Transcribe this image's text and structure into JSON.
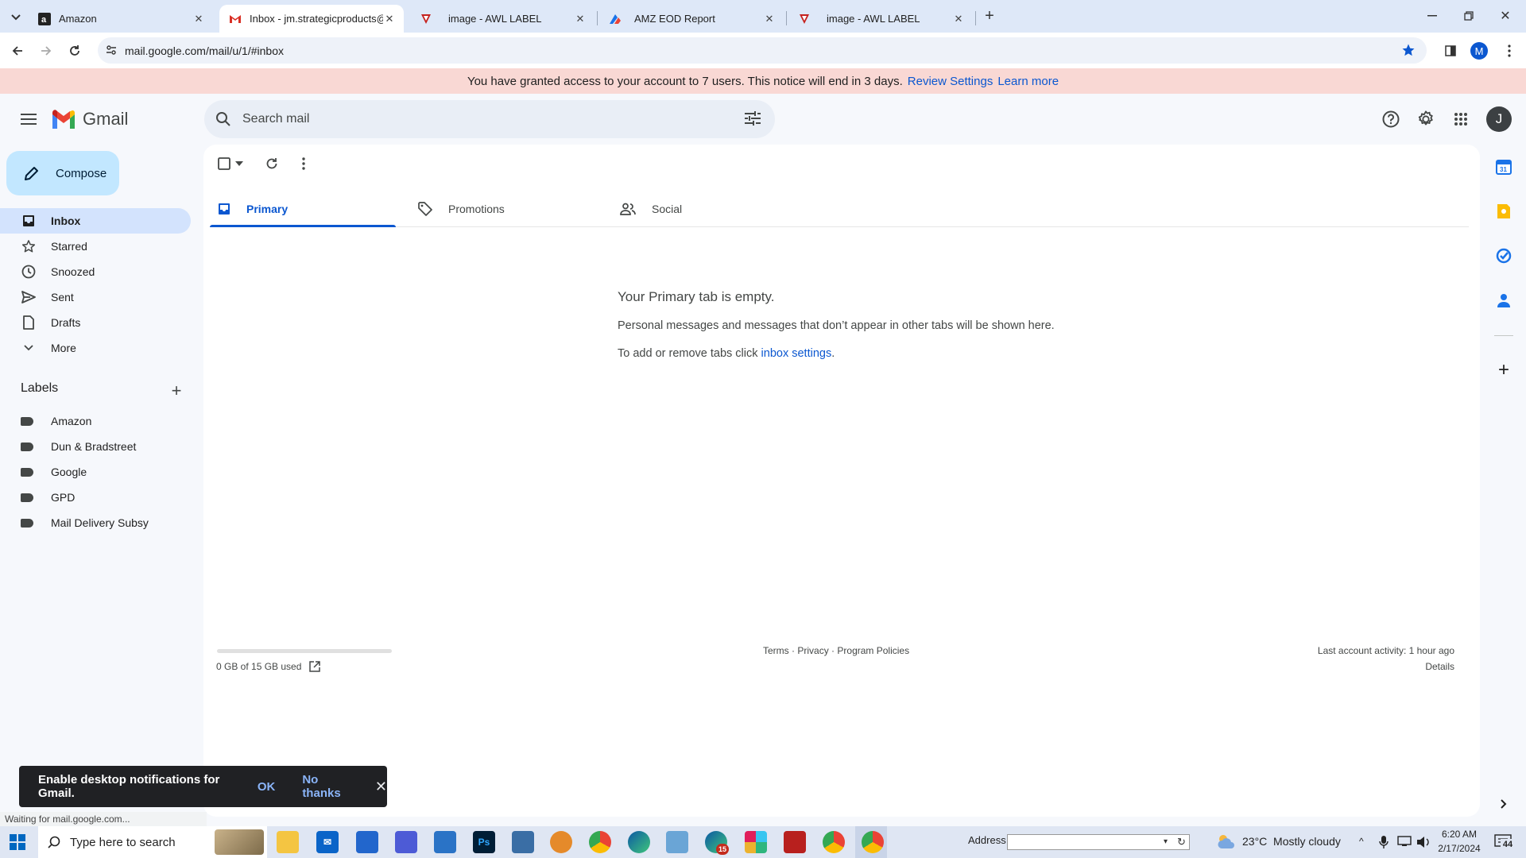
{
  "browser": {
    "tabs": [
      {
        "title": "Amazon"
      },
      {
        "title": "Inbox - jm.strategicproducts@g"
      },
      {
        "title": "image - AWL LABEL"
      },
      {
        "title": "AMZ EOD Report"
      },
      {
        "title": "image - AWL LABEL"
      }
    ],
    "url": "mail.google.com/mail/u/1/#inbox",
    "profile_initial": "M"
  },
  "notice": {
    "text": "You have granted access to your account to 7 users. This notice will end in 3 days.",
    "review_link": "Review Settings",
    "learn_link": "Learn more"
  },
  "gmail": {
    "logo_text": "Gmail",
    "search_placeholder": "Search mail",
    "avatar_initial": "J",
    "compose_label": "Compose",
    "nav": [
      {
        "label": "Inbox",
        "icon": "inbox-icon"
      },
      {
        "label": "Starred",
        "icon": "star-icon"
      },
      {
        "label": "Snoozed",
        "icon": "clock-icon"
      },
      {
        "label": "Sent",
        "icon": "send-icon"
      },
      {
        "label": "Drafts",
        "icon": "draft-icon"
      },
      {
        "label": "More",
        "icon": "chevron-down-icon"
      }
    ],
    "labels_heading": "Labels",
    "labels": [
      "Amazon",
      "Dun & Bradstreet",
      "Google",
      "GPD",
      "Mail Delivery Subsy"
    ],
    "category_tabs": [
      {
        "label": "Primary",
        "icon": "inbox-icon"
      },
      {
        "label": "Promotions",
        "icon": "tag-icon"
      },
      {
        "label": "Social",
        "icon": "people-icon"
      }
    ],
    "empty": {
      "title": "Your Primary tab is empty.",
      "line1": "Personal messages and messages that don’t appear in other tabs will be shown here.",
      "line2_prefix": "To add or remove tabs click",
      "line2_link": "inbox settings",
      "line2_suffix": "."
    },
    "footer": {
      "storage": "0 GB of 15 GB used",
      "storage_fraction": 0.0,
      "terms": "Terms",
      "privacy": "Privacy",
      "policies": "Program Policies",
      "sep": "·",
      "activity": "Last account activity: 1 hour ago",
      "details": "Details"
    }
  },
  "toast": {
    "text": "Enable desktop notifications for Gmail.",
    "ok": "OK",
    "no": "No thanks"
  },
  "status_bar": "Waiting for mail.google.com...",
  "taskbar": {
    "search_placeholder": "Type here to search",
    "address_label": "Address",
    "weather": "23°C  Mostly cloudy",
    "time": "6:20 AM",
    "date": "2/17/2024",
    "notif_count": "44",
    "edge_badge": "15"
  },
  "colors": {
    "accent": "#0b57d0",
    "compose_bg": "#c2e7ff",
    "active_nav": "#d3e3fd",
    "notice_bg": "#f9d8d4"
  }
}
